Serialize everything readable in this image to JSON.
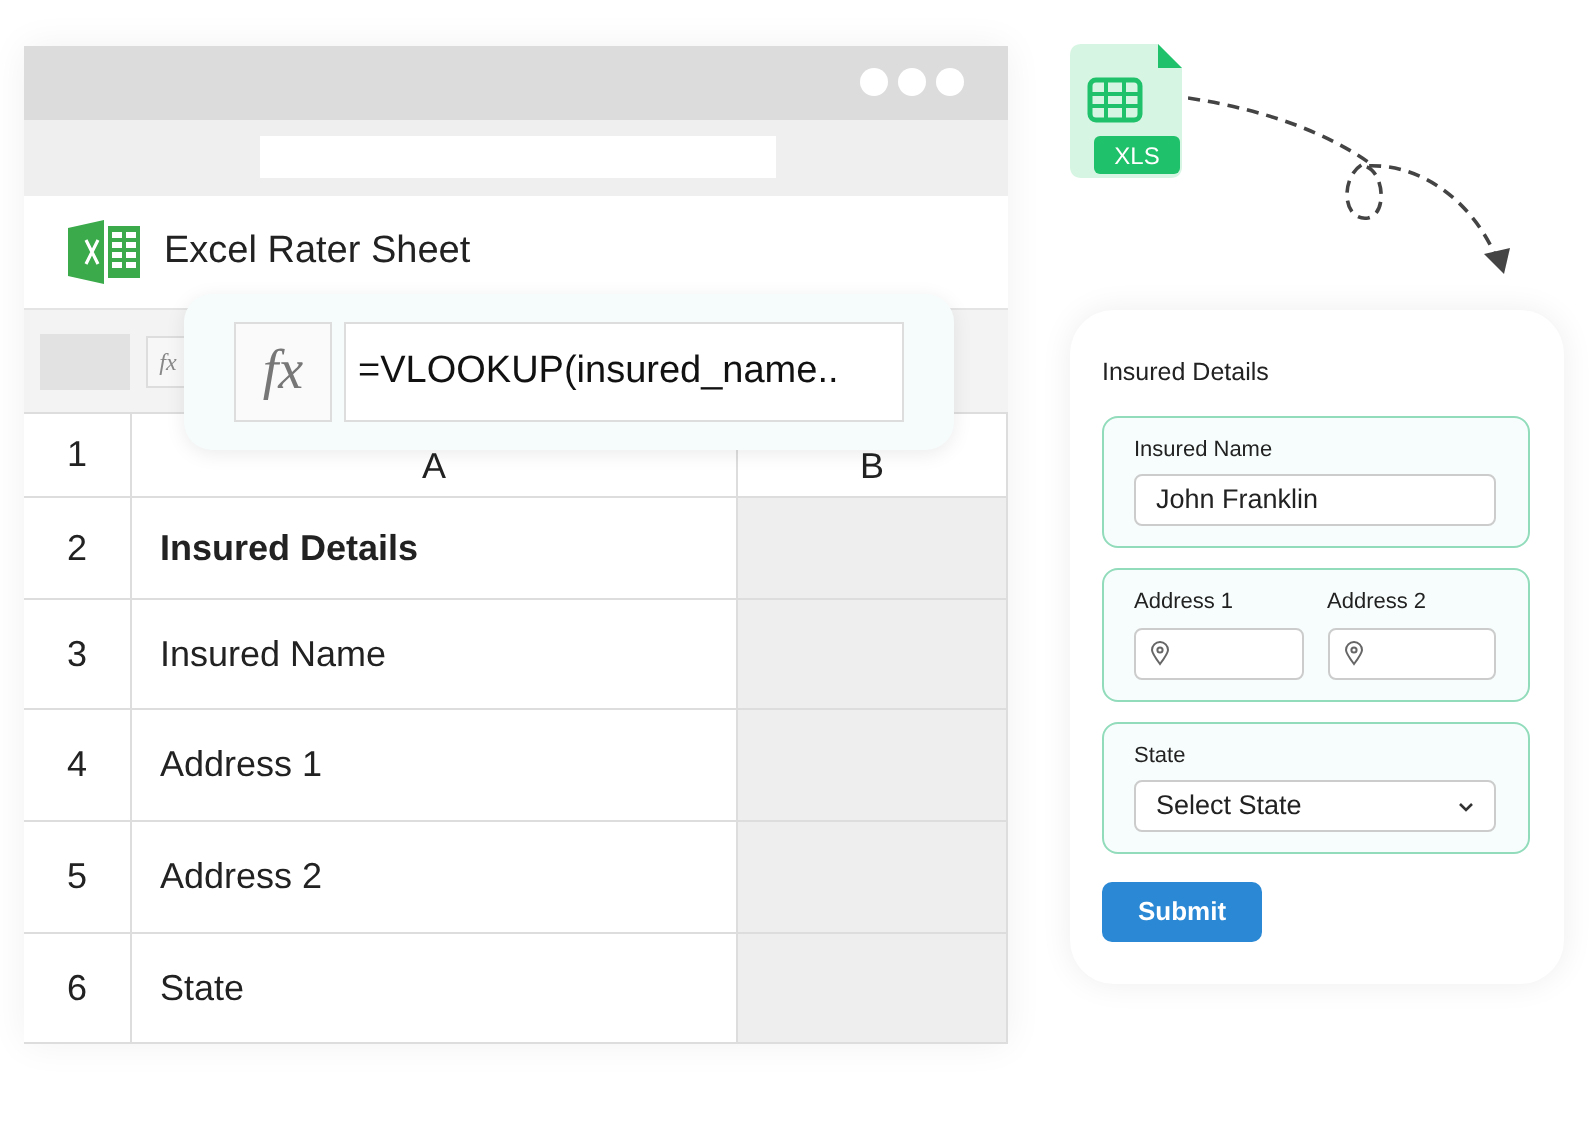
{
  "sheet": {
    "title": "Excel Rater Sheet",
    "toolbar_icon": "fx",
    "formula": {
      "icon": "fx",
      "value": "=VLOOKUP(insured_name.."
    },
    "header": {
      "row_number": "1",
      "columns": [
        "A",
        "B"
      ]
    },
    "rows": [
      {
        "number": "2",
        "cell": "Insured Details",
        "kind": "heading"
      },
      {
        "number": "3",
        "cell": "Insured Name",
        "kind": "label"
      },
      {
        "number": "4",
        "cell": "Address 1",
        "kind": "label"
      },
      {
        "number": "5",
        "cell": "Address 2",
        "kind": "label"
      },
      {
        "number": "6",
        "cell": "State",
        "kind": "label"
      }
    ]
  },
  "file_badge": "XLS",
  "form": {
    "title": "Insured Details",
    "groups": [
      {
        "kind": "text",
        "fields": [
          {
            "label": "Insured Name",
            "value": "John Franklin"
          }
        ]
      },
      {
        "kind": "location",
        "fields": [
          {
            "label": "Address 1"
          },
          {
            "label": "Address 2"
          }
        ]
      },
      {
        "kind": "select",
        "fields": [
          {
            "label": "State",
            "value": "Select State"
          }
        ]
      }
    ],
    "submit": "Submit"
  }
}
